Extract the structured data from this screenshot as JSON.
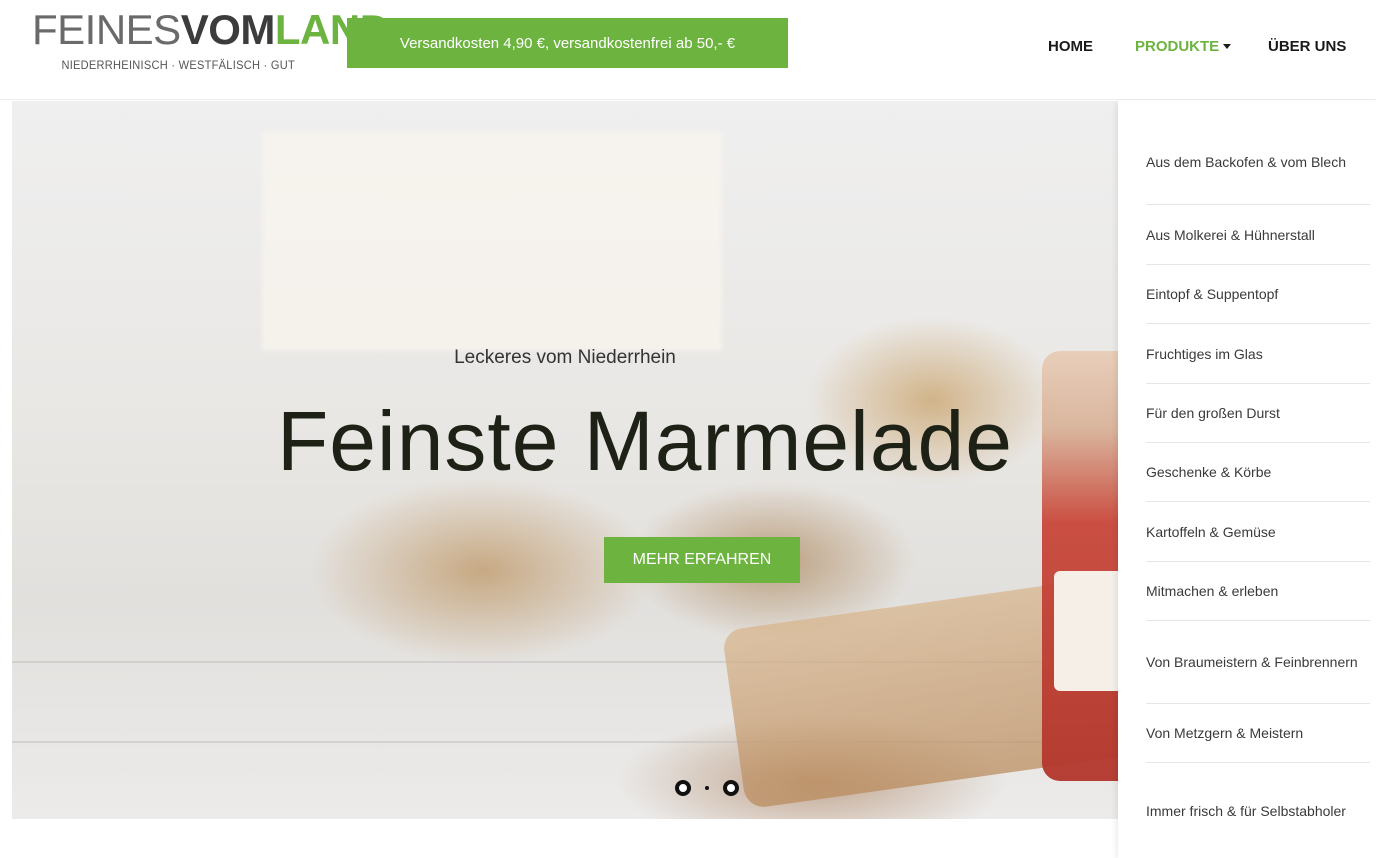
{
  "header": {
    "logo": {
      "part1": "FEINES",
      "part2": "VOM",
      "part3": "LAND",
      "tagline": "NIEDERRHEINISCH · WESTFÄLISCH · GUT"
    },
    "shipping_notice": "Versandkosten 4,90 €, versandkostenfrei ab 50,- €",
    "nav": {
      "home": "HOME",
      "produkte": "PRODUKTE",
      "ueber_uns": "ÜBER UNS"
    },
    "colors": {
      "brand_green": "#6db33f",
      "logo_dark": "#3c3c3c"
    }
  },
  "hero": {
    "subtitle": "Leckeres vom Niederrhein",
    "title": "Feinste Marmelade",
    "cta": "MEHR ERFAHREN",
    "slides": {
      "count": 2,
      "active": 1
    }
  },
  "dropdown": {
    "items": [
      "Aus dem Backofen & vom Blech",
      "Aus Molkerei & Hühnerstall",
      "Eintopf & Suppentopf",
      "Fruchtiges im Glas",
      "Für den großen Durst",
      "Geschenke & Körbe",
      "Kartoffeln & Gemüse",
      "Mitmachen & erleben",
      "Von Braumeistern & Feinbrennern",
      "Von Metzgern & Meistern",
      "Immer frisch & für Selbstabholer"
    ]
  }
}
